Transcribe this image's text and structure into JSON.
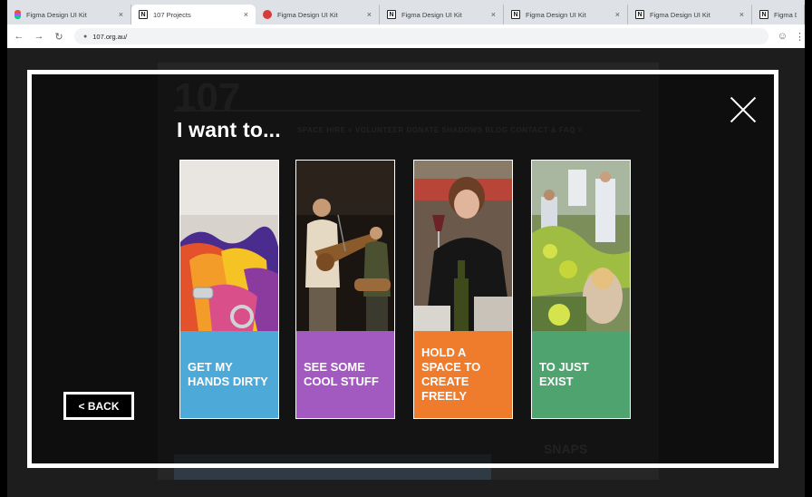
{
  "browser": {
    "tabs": [
      {
        "title": "Figma Design UI Kit",
        "icon": "figma-icon"
      },
      {
        "title": "107 Projects",
        "icon": "notion-icon",
        "active": true
      },
      {
        "title": "Figma Design UI Kit",
        "icon": "figma-red-icon"
      },
      {
        "title": "Figma Design UI Kit",
        "icon": "notion-icon"
      },
      {
        "title": "Figma Design UI Kit",
        "icon": "notion-icon"
      },
      {
        "title": "Figma Design UI Kit",
        "icon": "notion-icon"
      },
      {
        "title": "Figma De",
        "icon": "notion-icon"
      }
    ],
    "close_glyph": "×",
    "url": "107.org.au/"
  },
  "background_site": {
    "logo": "107",
    "menu": "SPACE HIRE ˅    VOLUNTEER    DONATE    SHADOWS    BLOG    CONTACT & FAQ ˅",
    "snaps": "SNAPS"
  },
  "modal": {
    "heading": "I want to...",
    "back_label": "< BACK",
    "cards": [
      {
        "label": "GET MY HANDS DIRTY",
        "color": "#4da9d8"
      },
      {
        "label": "SEE SOME COOL STUFF",
        "color": "#a35ac0"
      },
      {
        "label": "HOLD A SPACE TO CREATE FREELY",
        "color": "#ef7b2c"
      },
      {
        "label": "TO JUST EXIST",
        "color": "#4fa36e"
      }
    ]
  }
}
